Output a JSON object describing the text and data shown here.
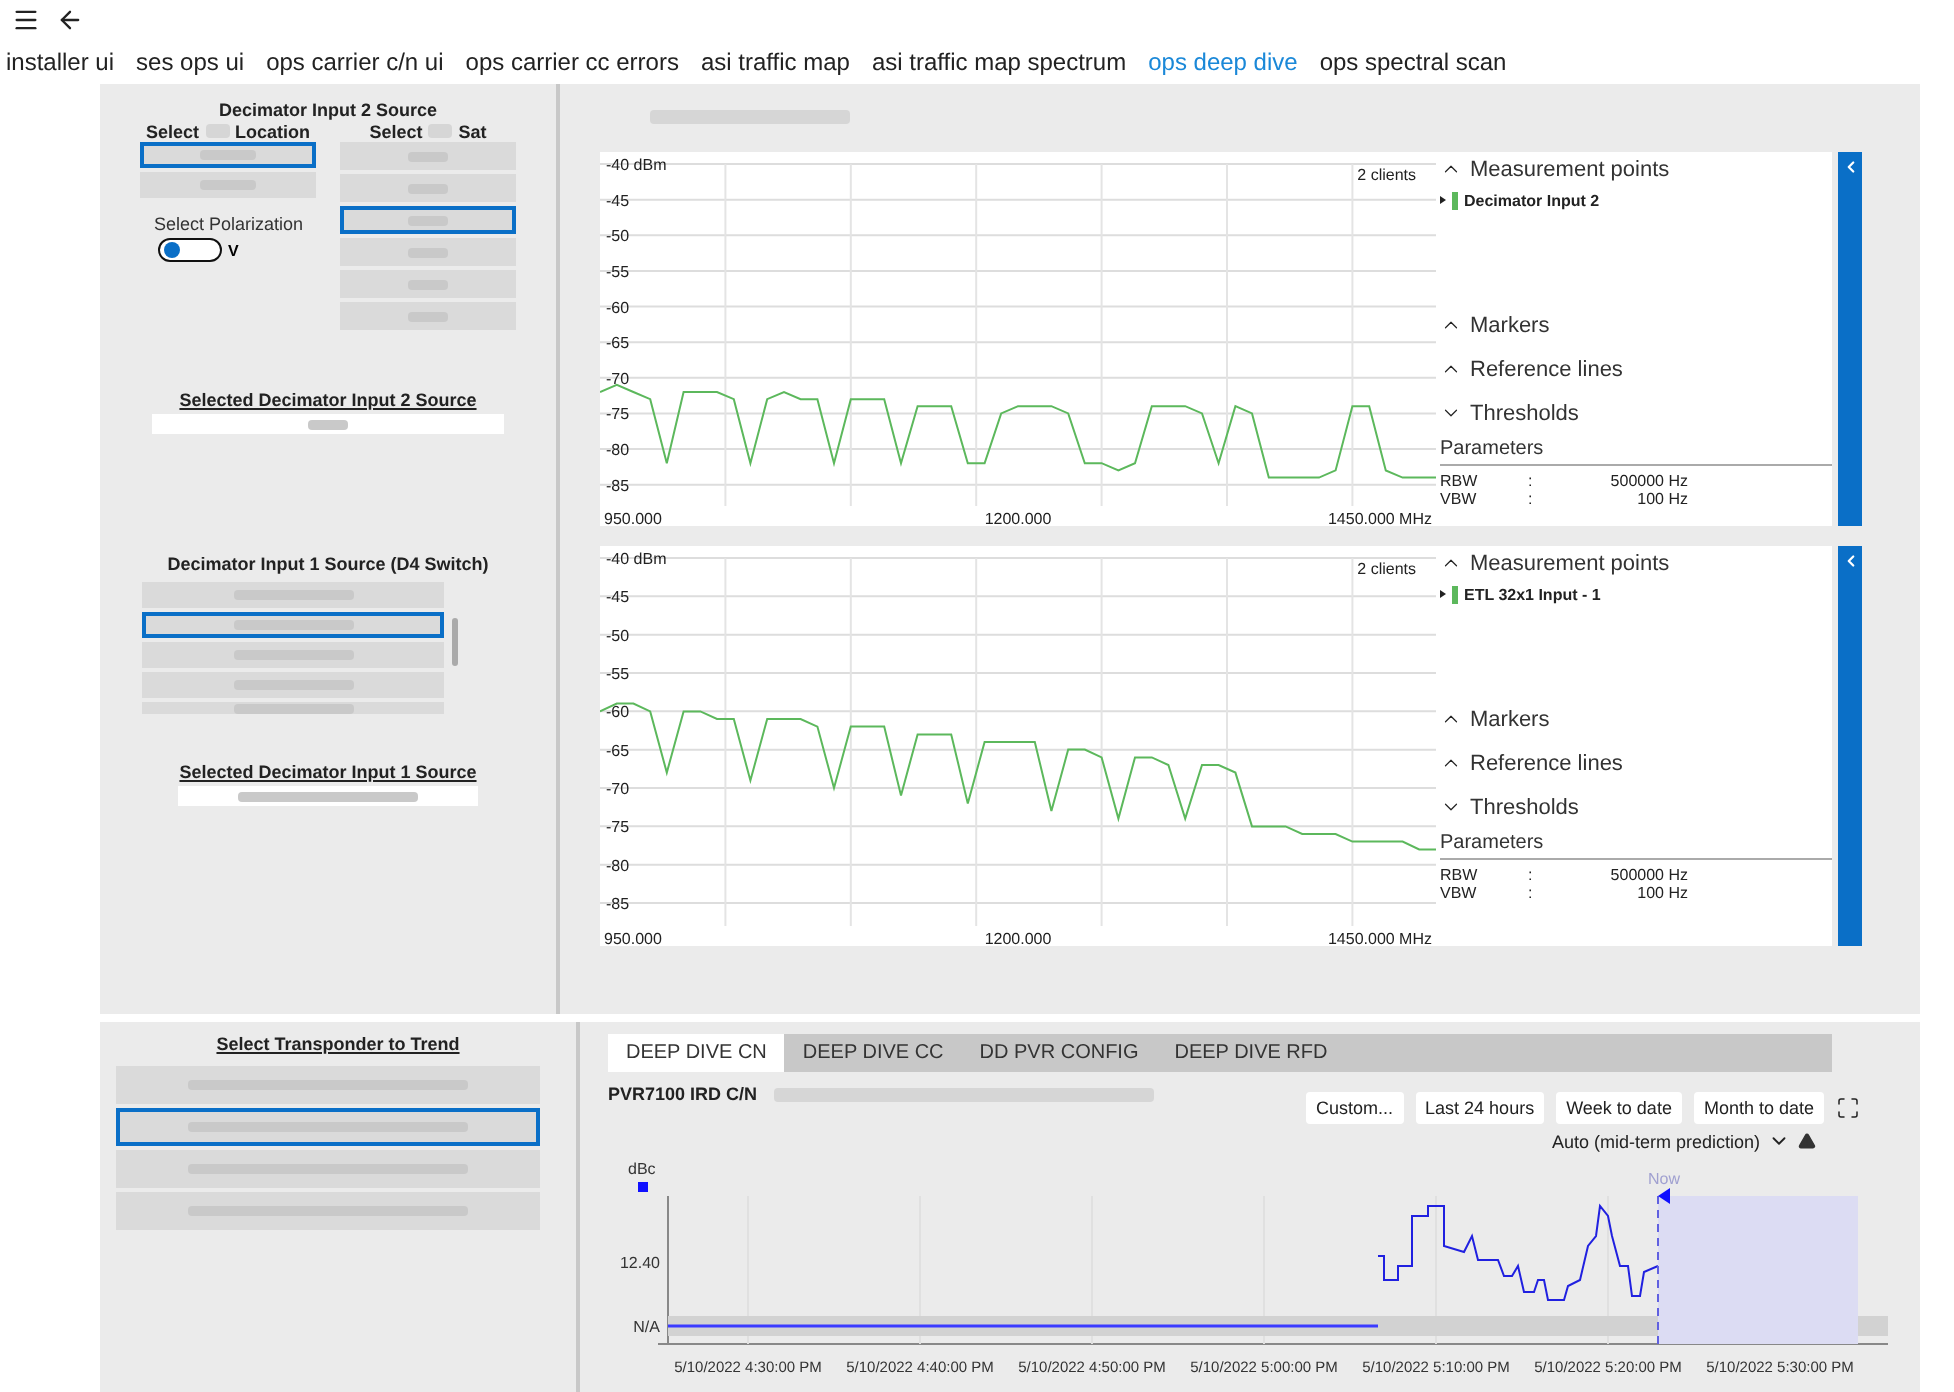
{
  "nav_tabs": [
    {
      "label": "installer ui",
      "selected": false
    },
    {
      "label": "ses ops ui",
      "selected": false
    },
    {
      "label": "ops carrier c/n ui",
      "selected": false
    },
    {
      "label": "ops carrier cc errors",
      "selected": false
    },
    {
      "label": "asi traffic map",
      "selected": false
    },
    {
      "label": "asi traffic map spectrum",
      "selected": false
    },
    {
      "label": "ops deep dive",
      "selected": true
    },
    {
      "label": "ops spectral scan",
      "selected": false
    }
  ],
  "decimator2": {
    "title": "Decimator Input 2 Source",
    "location_header": [
      "Select",
      "Location"
    ],
    "sat_header": [
      "Select",
      "Sat"
    ],
    "locations": [
      {
        "selected": true
      },
      {
        "selected": false
      }
    ],
    "sats": [
      {
        "selected": false
      },
      {
        "selected": false
      },
      {
        "selected": true
      },
      {
        "selected": false
      },
      {
        "selected": false
      },
      {
        "selected": false
      }
    ],
    "polarization_label": "Select Polarization",
    "polarization": {
      "on": false,
      "label": "V"
    },
    "selected_title": "Selected Decimator Input 2 Source"
  },
  "decimator1": {
    "title": "Decimator Input 1 Source (D4 Switch)",
    "items": [
      {
        "selected": false
      },
      {
        "selected": true
      },
      {
        "selected": false
      },
      {
        "selected": false
      },
      {
        "selected": false
      }
    ],
    "selected_title": "Selected Decimator Input 1 Source"
  },
  "spectra": [
    {
      "clients": "2 clients",
      "sections": [
        {
          "label": "Measurement points",
          "expanded": true
        },
        {
          "label": "Markers",
          "expanded": true
        },
        {
          "label": "Reference lines",
          "expanded": true
        },
        {
          "label": "Thresholds",
          "expanded": false
        }
      ],
      "parameters_title": "Parameters",
      "params": [
        {
          "name": "RBW",
          "sep": ":",
          "value": "500000 Hz"
        },
        {
          "name": "VBW",
          "sep": ":",
          "value": "100 Hz"
        }
      ],
      "chart_data": {
        "type": "line",
        "grid": true,
        "xlim": [
          950,
          1450
        ],
        "ylim": [
          -88,
          -40
        ],
        "xticks": [
          {
            "value": 950,
            "label": "950.000"
          },
          {
            "value": 1200,
            "label": "1200.000"
          },
          {
            "value": 1450,
            "label": "1450.000 MHz"
          }
        ],
        "yticks": [
          {
            "value": -40,
            "label": "-40 dBm"
          },
          -45,
          -50,
          -55,
          -60,
          -65,
          -70,
          -75,
          -80,
          -85
        ],
        "x": [
          950,
          960,
          970,
          980,
          990,
          1000,
          1010,
          1020,
          1030,
          1040,
          1050,
          1060,
          1070,
          1080,
          1090,
          1100,
          1110,
          1120,
          1130,
          1140,
          1150,
          1160,
          1170,
          1180,
          1190,
          1200,
          1210,
          1220,
          1230,
          1240,
          1250,
          1260,
          1270,
          1280,
          1290,
          1300,
          1310,
          1320,
          1330,
          1340,
          1350,
          1360,
          1370,
          1380,
          1390,
          1400,
          1410,
          1420,
          1430,
          1440,
          1450
        ],
        "series": [
          {
            "name": "Decimator Input 2",
            "color": "#5cb85c",
            "values": [
              -72,
              -71,
              -72,
              -73,
              -82,
              -72,
              -72,
              -72,
              -73,
              -82,
              -73,
              -72,
              -73,
              -73,
              -82,
              -73,
              -73,
              -73,
              -82,
              -74,
              -74,
              -74,
              -82,
              -82,
              -75,
              -74,
              -74,
              -74,
              -75,
              -82,
              -82,
              -83,
              -82,
              -74,
              -74,
              -74,
              -75,
              -82,
              -74,
              -75,
              -84,
              -84,
              -84,
              -84,
              -83,
              -74,
              -74,
              -83,
              -84,
              -84,
              -84
            ]
          }
        ]
      }
    },
    {
      "clients": "2 clients",
      "sections": [
        {
          "label": "Measurement points",
          "expanded": true
        },
        {
          "label": "Markers",
          "expanded": true
        },
        {
          "label": "Reference lines",
          "expanded": true
        },
        {
          "label": "Thresholds",
          "expanded": false
        }
      ],
      "parameters_title": "Parameters",
      "params": [
        {
          "name": "RBW",
          "sep": ":",
          "value": "500000 Hz"
        },
        {
          "name": "VBW",
          "sep": ":",
          "value": "100 Hz"
        }
      ],
      "chart_data": {
        "type": "line",
        "grid": true,
        "xlim": [
          950,
          1450
        ],
        "ylim": [
          -88,
          -40
        ],
        "xticks": [
          {
            "value": 950,
            "label": "950.000"
          },
          {
            "value": 1200,
            "label": "1200.000"
          },
          {
            "value": 1450,
            "label": "1450.000 MHz"
          }
        ],
        "yticks": [
          {
            "value": -40,
            "label": "-40 dBm"
          },
          -45,
          -50,
          -55,
          -60,
          -65,
          -70,
          -75,
          -80,
          -85
        ],
        "x": [
          950,
          960,
          970,
          980,
          990,
          1000,
          1010,
          1020,
          1030,
          1040,
          1050,
          1060,
          1070,
          1080,
          1090,
          1100,
          1110,
          1120,
          1130,
          1140,
          1150,
          1160,
          1170,
          1180,
          1190,
          1200,
          1210,
          1220,
          1230,
          1240,
          1250,
          1260,
          1270,
          1280,
          1290,
          1300,
          1310,
          1320,
          1330,
          1340,
          1350,
          1360,
          1370,
          1380,
          1390,
          1400,
          1410,
          1420,
          1430,
          1440,
          1450
        ],
        "series": [
          {
            "name": "ETL 32x1 Input - 1",
            "color": "#5cb85c",
            "values": [
              -60,
              -59,
              -59,
              -60,
              -68,
              -60,
              -60,
              -61,
              -61,
              -69,
              -61,
              -61,
              -61,
              -62,
              -70,
              -62,
              -62,
              -62,
              -71,
              -63,
              -63,
              -63,
              -72,
              -64,
              -64,
              -64,
              -64,
              -73,
              -65,
              -65,
              -66,
              -74,
              -66,
              -66,
              -67,
              -74,
              -67,
              -67,
              -68,
              -75,
              -75,
              -75,
              -76,
              -76,
              -76,
              -77,
              -77,
              -77,
              -77,
              -78,
              -78
            ]
          }
        ]
      }
    }
  ],
  "transponders": {
    "title": "Select Transponder to Trend",
    "items": [
      {
        "selected": false
      },
      {
        "selected": true
      },
      {
        "selected": false
      },
      {
        "selected": false
      }
    ]
  },
  "trend": {
    "tabs": [
      {
        "label": "DEEP DIVE CN",
        "selected": true
      },
      {
        "label": "DEEP DIVE CC",
        "selected": false
      },
      {
        "label": "DD PVR CONFIG",
        "selected": false
      },
      {
        "label": "DEEP DIVE RFD",
        "selected": false
      }
    ],
    "title": "PVR7100 IRD C/N",
    "ranges": [
      "Custom...",
      "Last 24 hours",
      "Week to date",
      "Month to date"
    ],
    "mode": "Auto (mid-term prediction)",
    "unit": "dBc",
    "y_labels": [
      "12.40",
      "N/A"
    ],
    "now_label": "Now",
    "x_labels": [
      "5/10/2022 4:30:00 PM",
      "5/10/2022 4:40:00 PM",
      "5/10/2022 4:50:00 PM",
      "5/10/2022 5:00:00 PM",
      "5/10/2022 5:10:00 PM",
      "5/10/2022 5:20:00 PM",
      "5/10/2022 5:30:00 PM"
    ]
  }
}
